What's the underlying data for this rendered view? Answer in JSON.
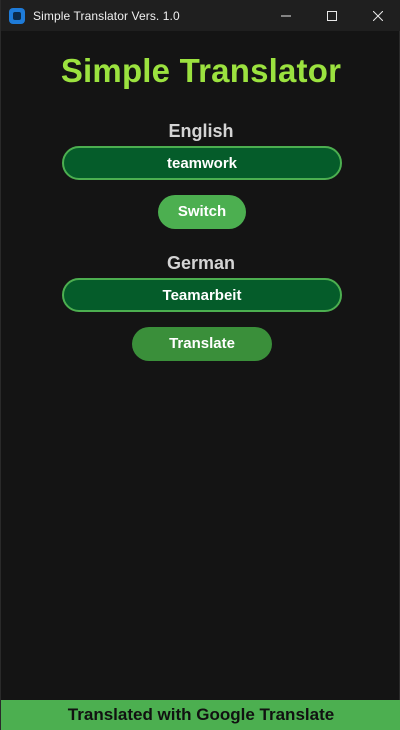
{
  "window": {
    "title": "Simple Translator Vers. 1.0"
  },
  "app": {
    "heading": "Simple Translator",
    "source": {
      "language": "English",
      "value": "teamwork"
    },
    "switch_label": "Switch",
    "target": {
      "language": "German",
      "value": "Teamarbeit"
    },
    "translate_label": "Translate",
    "footer": "Translated with Google Translate"
  },
  "colors": {
    "heading": "#9be23f",
    "field_bg": "#055c2a",
    "field_border": "#4caf50",
    "switch_bg": "#4caf50",
    "translate_bg": "#3a8f3a",
    "footer_bg": "#4caf50",
    "window_bg": "#141414"
  },
  "icons": {
    "app": "app-icon",
    "minimize": "minimize-icon",
    "maximize": "maximize-icon",
    "close": "close-icon"
  }
}
